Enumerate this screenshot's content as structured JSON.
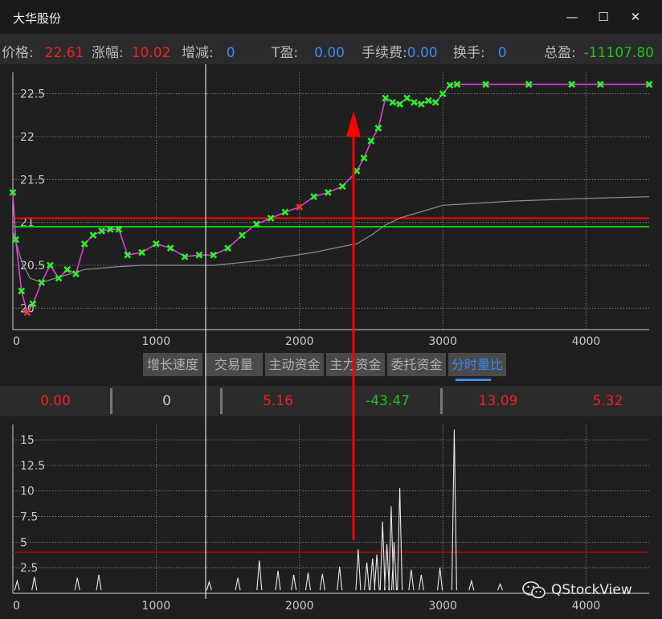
{
  "window": {
    "title": "大华股份",
    "minimize": "—",
    "maximize": "☐",
    "close": "✕"
  },
  "stats": [
    {
      "label": "价格:",
      "value": "22.61",
      "color": "red"
    },
    {
      "label": "涨幅:",
      "value": "10.02",
      "color": "red"
    },
    {
      "label": "增减:",
      "value": "0",
      "color": "blue"
    },
    {
      "label": "T盈:",
      "value": "0.00",
      "color": "blue"
    },
    {
      "label": "手续费:",
      "value": "0.00",
      "color": "blue"
    },
    {
      "label": "换手:",
      "value": "0",
      "color": "blue"
    },
    {
      "label": "总盈:",
      "value": "-11107.80",
      "color": "green"
    }
  ],
  "tabs": [
    "增长速度",
    "交易量",
    "主动资金",
    "主力资金",
    "委托资金",
    "分时量比"
  ],
  "active_tab": 5,
  "values": [
    "0.00",
    "0",
    "5.16",
    "-43.47",
    "13.09",
    "5.32"
  ],
  "watermark": "QStockView",
  "colors": {
    "price_line": "#e040e0",
    "marker": "#20ff20",
    "sell_marker": "#ff3030",
    "avg_line": "#909090",
    "limit_line": "#ff0000",
    "base_line": "#00cc00",
    "arrow": "#ff0000",
    "ratio_line": "#e8e8e8",
    "threshold_line": "#c00000"
  },
  "chart_data": [
    {
      "type": "line",
      "xlim": [
        0,
        4440
      ],
      "ylim": [
        19.75,
        22.75
      ],
      "x_ticks": [
        0,
        1000,
        2000,
        3000,
        4000
      ],
      "y_ticks": [
        20,
        20.5,
        21,
        21.5,
        22,
        22.5
      ],
      "grid": true,
      "series": [
        {
          "x": [
            0,
            20,
            60,
            100,
            140,
            200,
            260,
            320,
            380,
            440,
            500,
            560,
            620,
            680,
            740,
            800,
            900,
            1000,
            1100,
            1200,
            1300,
            1400,
            1500,
            1600,
            1700,
            1800,
            1900,
            2000,
            2100,
            2200,
            2300,
            2400,
            2450,
            2500,
            2550,
            2600,
            2650,
            2700,
            2750,
            2800,
            2850,
            2900,
            2950,
            3000,
            3050,
            3100,
            3300,
            3600,
            3900,
            4100,
            4440
          ],
          "y": [
            21.35,
            20.8,
            20.2,
            19.95,
            20.05,
            20.3,
            20.5,
            20.35,
            20.45,
            20.4,
            20.75,
            20.85,
            20.9,
            20.92,
            20.92,
            20.62,
            20.65,
            20.75,
            20.7,
            20.6,
            20.62,
            20.62,
            20.7,
            20.85,
            20.98,
            21.05,
            21.12,
            21.18,
            21.3,
            21.35,
            21.42,
            21.6,
            21.75,
            21.95,
            22.1,
            22.45,
            22.4,
            22.38,
            22.45,
            22.4,
            22.38,
            22.42,
            22.4,
            22.5,
            22.6,
            22.61,
            22.61,
            22.61,
            22.61,
            22.61,
            22.61
          ]
        },
        {
          "x": [
            0,
            60,
            120,
            200,
            300,
            400,
            500,
            700,
            900,
            1100,
            1400,
            1700,
            1900,
            2100,
            2300,
            2400,
            2500,
            2600,
            2700,
            2800,
            3000,
            3500,
            4000,
            4440
          ],
          "y": [
            20.9,
            20.55,
            20.35,
            20.3,
            20.35,
            20.4,
            20.45,
            20.48,
            20.5,
            20.5,
            20.5,
            20.55,
            20.6,
            20.65,
            20.72,
            20.75,
            20.85,
            20.97,
            21.05,
            21.1,
            21.2,
            21.25,
            21.28,
            21.3
          ]
        }
      ],
      "reference_lines": [
        21.05,
        20.95
      ]
    },
    {
      "type": "line",
      "xlim": [
        0,
        4440
      ],
      "ylim": [
        0,
        16.5
      ],
      "x_ticks": [
        0,
        1000,
        2000,
        3000,
        4000
      ],
      "y_ticks": [
        2.5,
        5,
        7.5,
        10,
        12.5,
        15
      ],
      "grid": true,
      "threshold": 4,
      "spikes": [
        {
          "x": 30,
          "y": 1.2
        },
        {
          "x": 150,
          "y": 1.6
        },
        {
          "x": 450,
          "y": 1.5
        },
        {
          "x": 600,
          "y": 1.8
        },
        {
          "x": 1370,
          "y": 1.1
        },
        {
          "x": 1570,
          "y": 1.5
        },
        {
          "x": 1720,
          "y": 3.2
        },
        {
          "x": 1850,
          "y": 2.2
        },
        {
          "x": 1960,
          "y": 1.8
        },
        {
          "x": 2060,
          "y": 2.0
        },
        {
          "x": 2160,
          "y": 1.9
        },
        {
          "x": 2280,
          "y": 2.6
        },
        {
          "x": 2410,
          "y": 4.3
        },
        {
          "x": 2470,
          "y": 3.0
        },
        {
          "x": 2510,
          "y": 3.4
        },
        {
          "x": 2540,
          "y": 3.8
        },
        {
          "x": 2580,
          "y": 7.0
        },
        {
          "x": 2610,
          "y": 4.8
        },
        {
          "x": 2640,
          "y": 8.5
        },
        {
          "x": 2660,
          "y": 5.0
        },
        {
          "x": 2700,
          "y": 10.3
        },
        {
          "x": 2780,
          "y": 2.3
        },
        {
          "x": 2850,
          "y": 1.8
        },
        {
          "x": 2980,
          "y": 2.5
        },
        {
          "x": 3080,
          "y": 16.0
        },
        {
          "x": 3200,
          "y": 1.2
        },
        {
          "x": 3400,
          "y": 0.9
        }
      ]
    }
  ]
}
